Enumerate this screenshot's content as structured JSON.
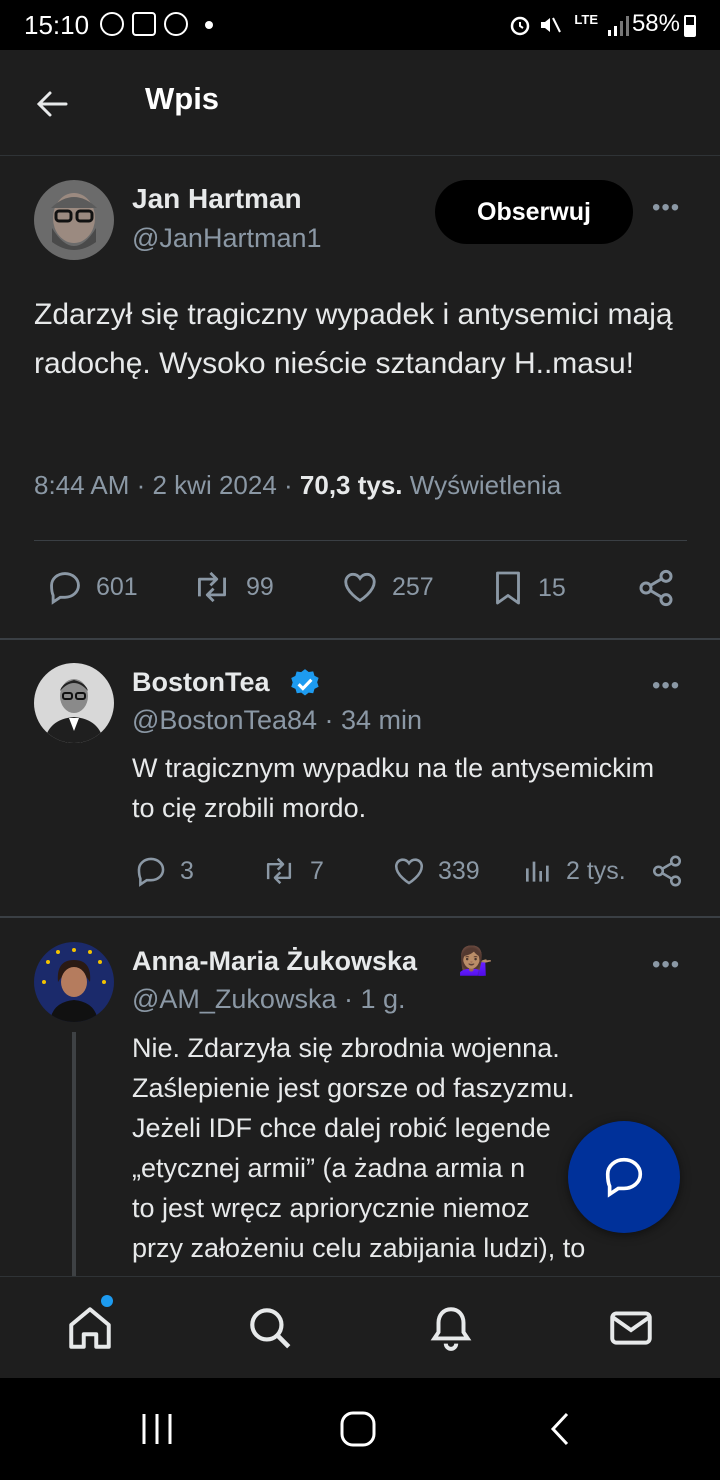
{
  "status_bar": {
    "time": "15:10",
    "battery": "58%",
    "network": "LTE"
  },
  "app_bar": {
    "title": "Wpis",
    "back_icon": "arrow-left-icon"
  },
  "main_post": {
    "author_name": "Jan Hartman",
    "handle": "@JanHartman1",
    "follow_label": "Obserwuj",
    "text": "Zdarzył się tragiczny wypadek i antysemici mają radochę. Wysoko nieście sztandary H..masu!",
    "time": "8:44 AM · 2 kwi 2024 · ",
    "views_count": "70,3 tys.",
    "views_label": " Wyświetlenia",
    "replies": "601",
    "reposts": "99",
    "likes": "257",
    "bookmarks": "15"
  },
  "reply1": {
    "author_name": "BostonTea",
    "verified": true,
    "handle_time": "@BostonTea84 · 34 min",
    "text": "W tragicznym wypadku na tle antysemickim to cię zrobili mordo.",
    "replies": "3",
    "reposts": "7",
    "likes": "339",
    "views": "2 tys."
  },
  "reply2": {
    "author_name": "Anna-Maria Żukowska",
    "emoji": "💁🏽‍♀️",
    "handle_time": "@AM_Zukowska · 1 g.",
    "text_lines": [
      "Nie. Zdarzyła się zbrodnia wojenna.",
      "Zaślepienie jest gorsze od faszyzmu.",
      "Jeżeli IDF chce dalej robić legende",
      "„etycznej armii” (a żadna armia n",
      "to jest wręcz apriorycznie niemoz",
      "przy założeniu celu zabijania ludzi), to"
    ]
  },
  "bottom_nav": {
    "items": [
      "home-icon",
      "search-icon",
      "bell-icon",
      "mail-icon"
    ]
  },
  "colors": {
    "background": "#1e1e1e",
    "muted": "#8b98a5",
    "verified": "#1d9bf0",
    "fab": "#00319a"
  }
}
